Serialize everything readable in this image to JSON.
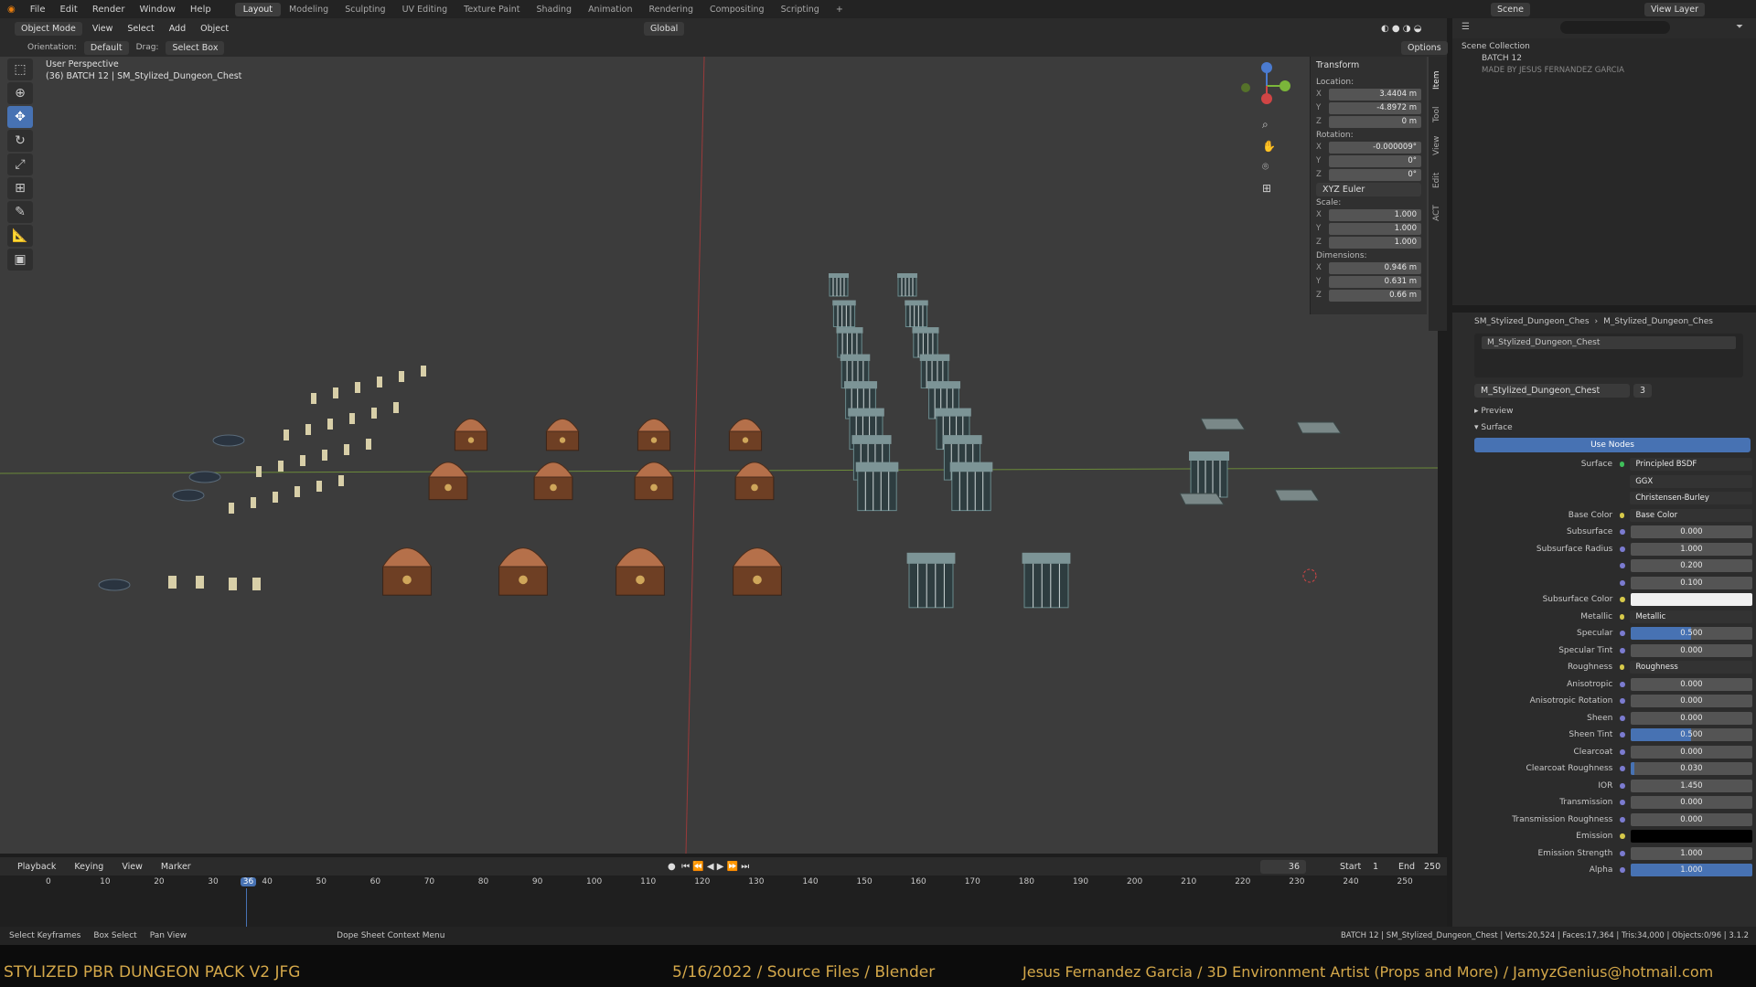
{
  "topmenu": [
    "File",
    "Edit",
    "Render",
    "Window",
    "Help"
  ],
  "workspaces": [
    "Layout",
    "Modeling",
    "Sculpting",
    "UV Editing",
    "Texture Paint",
    "Shading",
    "Animation",
    "Rendering",
    "Compositing",
    "Scripting"
  ],
  "scene": "Scene",
  "view_layer": "View Layer",
  "header": {
    "mode": "Object Mode",
    "view": "View",
    "select": "Select",
    "add": "Add",
    "object": "Object",
    "transform": "Global",
    "options": "Options"
  },
  "header3": {
    "orientation_label": "Orientation:",
    "orientation": "Default",
    "drag_label": "Drag:",
    "drag": "Select Box"
  },
  "viewport": {
    "perspective": "User Perspective",
    "object": "(36) BATCH 12 | SM_Stylized_Dungeon_Chest"
  },
  "npanel": {
    "title": "Transform",
    "location": "Location:",
    "loc": [
      "3.4404 m",
      "-4.8972 m",
      "0 m"
    ],
    "rotation": "Rotation:",
    "rot": [
      "-0.000009°",
      "0°",
      "0°"
    ],
    "euler": "XYZ Euler",
    "scale": "Scale:",
    "scl": [
      "1.000",
      "1.000",
      "1.000"
    ],
    "dimensions": "Dimensions:",
    "dim": [
      "0.946 m",
      "0.631 m",
      "0.66 m"
    ],
    "tabs": [
      "Item",
      "Tool",
      "View",
      "Edit",
      "ACT"
    ]
  },
  "outliner": {
    "root": "Scene Collection",
    "items": [
      "BATCH 12",
      "MADE BY JESUS FERNANDEZ GARCIA"
    ]
  },
  "props": {
    "breadcrumb1": "SM_Stylized_Dungeon_Ches",
    "breadcrumb2": "M_Stylized_Dungeon_Ches",
    "slot": "M_Stylized_Dungeon_Chest",
    "material": "M_Stylized_Dungeon_Chest",
    "users": "3",
    "preview": "Preview",
    "surface_section": "Surface",
    "use_nodes": "Use Nodes",
    "surface_label": "Surface",
    "surface": "Principled BSDF",
    "dist": "GGX",
    "sss_method": "Christensen-Burley",
    "rows": [
      {
        "l": "Base Color",
        "v": "Base Color",
        "link": true
      },
      {
        "l": "Subsurface",
        "v": "0.000"
      },
      {
        "l": "Subsurface Radius",
        "v": "1.000"
      },
      {
        "l": "",
        "v": "0.200"
      },
      {
        "l": "",
        "v": "0.100"
      },
      {
        "l": "Subsurface Color",
        "v": "",
        "swatch": "#f0f0f0"
      },
      {
        "l": "Metallic",
        "v": "Metallic",
        "link": true
      },
      {
        "l": "Specular",
        "v": "0.500",
        "fill": 0.5
      },
      {
        "l": "Specular Tint",
        "v": "0.000"
      },
      {
        "l": "Roughness",
        "v": "Roughness",
        "link": true
      },
      {
        "l": "Anisotropic",
        "v": "0.000"
      },
      {
        "l": "Anisotropic Rotation",
        "v": "0.000"
      },
      {
        "l": "Sheen",
        "v": "0.000"
      },
      {
        "l": "Sheen Tint",
        "v": "0.500",
        "fill": 0.5
      },
      {
        "l": "Clearcoat",
        "v": "0.000"
      },
      {
        "l": "Clearcoat Roughness",
        "v": "0.030",
        "fill": 0.03
      },
      {
        "l": "IOR",
        "v": "1.450"
      },
      {
        "l": "Transmission",
        "v": "0.000"
      },
      {
        "l": "Transmission Roughness",
        "v": "0.000"
      },
      {
        "l": "Emission",
        "v": "",
        "swatch": "#000000"
      },
      {
        "l": "Emission Strength",
        "v": "1.000"
      },
      {
        "l": "Alpha",
        "v": "1.000",
        "fill": 1.0
      }
    ]
  },
  "timeline": {
    "playback": "Playback",
    "keying": "Keying",
    "view": "View",
    "marker": "Marker",
    "current": "36",
    "start_label": "Start",
    "start": "1",
    "end_label": "End",
    "end": "250",
    "ticks": [
      "0",
      "10",
      "20",
      "30",
      "36",
      "40",
      "50",
      "60",
      "70",
      "80",
      "90",
      "100",
      "110",
      "120",
      "130",
      "140",
      "150",
      "160",
      "170",
      "180",
      "190",
      "200",
      "210",
      "220",
      "230",
      "240",
      "250"
    ]
  },
  "status": {
    "a": "Select Keyframes",
    "b": "Box Select",
    "c": "Pan View",
    "d": "Dope Sheet Context Menu",
    "stats": "BATCH 12 | SM_Stylized_Dungeon_Chest | Verts:20,524 | Faces:17,364 | Tris:34,000 | Objects:0/96 | 3.1.2"
  },
  "banner": {
    "left": "STYLIZED PBR DUNGEON PACK V2 JFG",
    "mid": "5/16/2022 / Source Files / Blender",
    "right": "Jesus Fernandez Garcia / 3D Environment Artist (Props and More) / JamyzGenius@hotmail.com"
  }
}
